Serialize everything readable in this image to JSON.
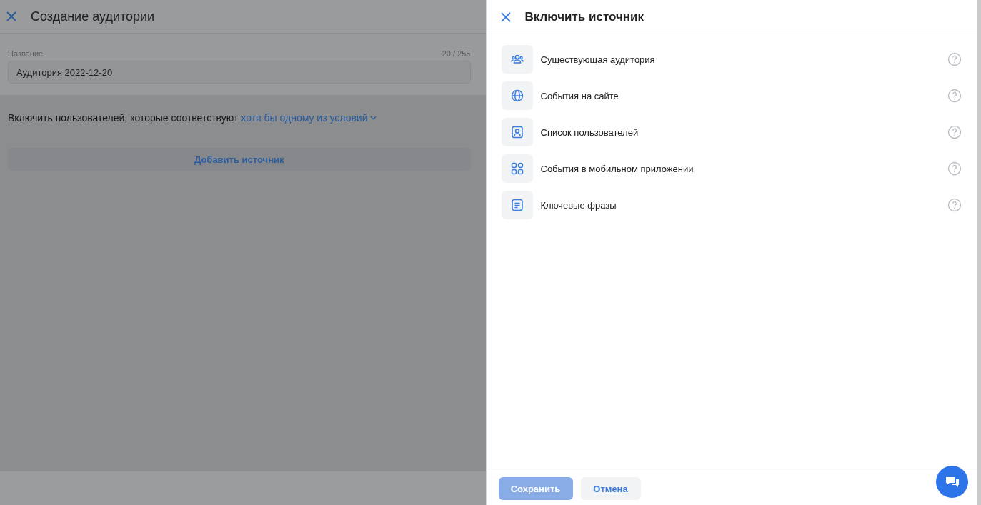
{
  "page": {
    "title": "Создание аудитории",
    "name_field": {
      "label": "Название",
      "counter": "20 / 255",
      "value": "Аудитория 2022-12-20"
    },
    "condition": {
      "text": "Включить пользователей, которые соответствуют",
      "link": "хотя бы одному из условий"
    },
    "add_source_button": "Добавить источник"
  },
  "drawer": {
    "title": "Включить источник",
    "sources": [
      {
        "kind": "audience",
        "label": "Существующая аудитория"
      },
      {
        "kind": "globe",
        "label": "События на сайте"
      },
      {
        "kind": "user-list",
        "label": "Список пользователей"
      },
      {
        "kind": "apps",
        "label": "События в мобильном приложении"
      },
      {
        "kind": "document",
        "label": "Ключевые фразы"
      }
    ],
    "save_button": {
      "label": "Сохранить",
      "disabled": true
    },
    "cancel_button": "Отмена"
  }
}
